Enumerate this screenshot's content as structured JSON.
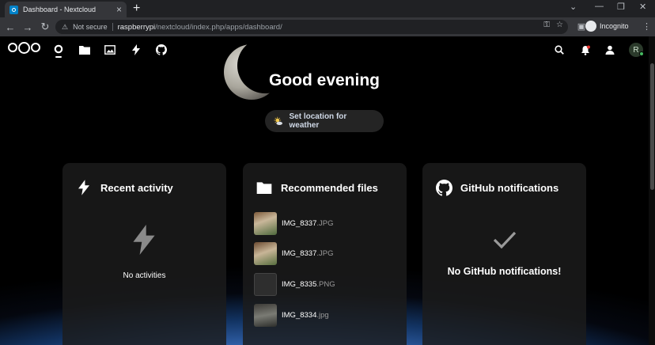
{
  "browser": {
    "tab_title": "Dashboard - Nextcloud",
    "not_secure": "Not secure",
    "url_host": "raspberrypi",
    "url_path": "/nextcloud/index.php/apps/dashboard/",
    "profile_label": "Incognito"
  },
  "nextcloud": {
    "avatar_initial": "R",
    "greeting": "Good evening",
    "weather_button": "Set location for weather",
    "panels": {
      "activity": {
        "title": "Recent activity",
        "empty": "No activities"
      },
      "files": {
        "title": "Recommended files",
        "items": [
          {
            "name": "IMG_8337",
            "ext": ".JPG"
          },
          {
            "name": "IMG_8337",
            "ext": ".JPG"
          },
          {
            "name": "IMG_8335",
            "ext": ".PNG"
          },
          {
            "name": "IMG_8334",
            "ext": ".jpg"
          }
        ]
      },
      "github": {
        "title": "GitHub notifications",
        "empty": "No GitHub notifications!"
      }
    }
  },
  "colors": {
    "accent": "#0082c9",
    "status_online": "#46ba61",
    "panel_bg": "#1c1c1c"
  },
  "icons": [
    "nextcloud-logo",
    "dashboard-icon",
    "files-icon",
    "photos-icon",
    "activity-icon",
    "github-icon",
    "search-icon",
    "notifications-icon",
    "contacts-icon",
    "check-icon",
    "folder-icon",
    "weather-icon"
  ]
}
